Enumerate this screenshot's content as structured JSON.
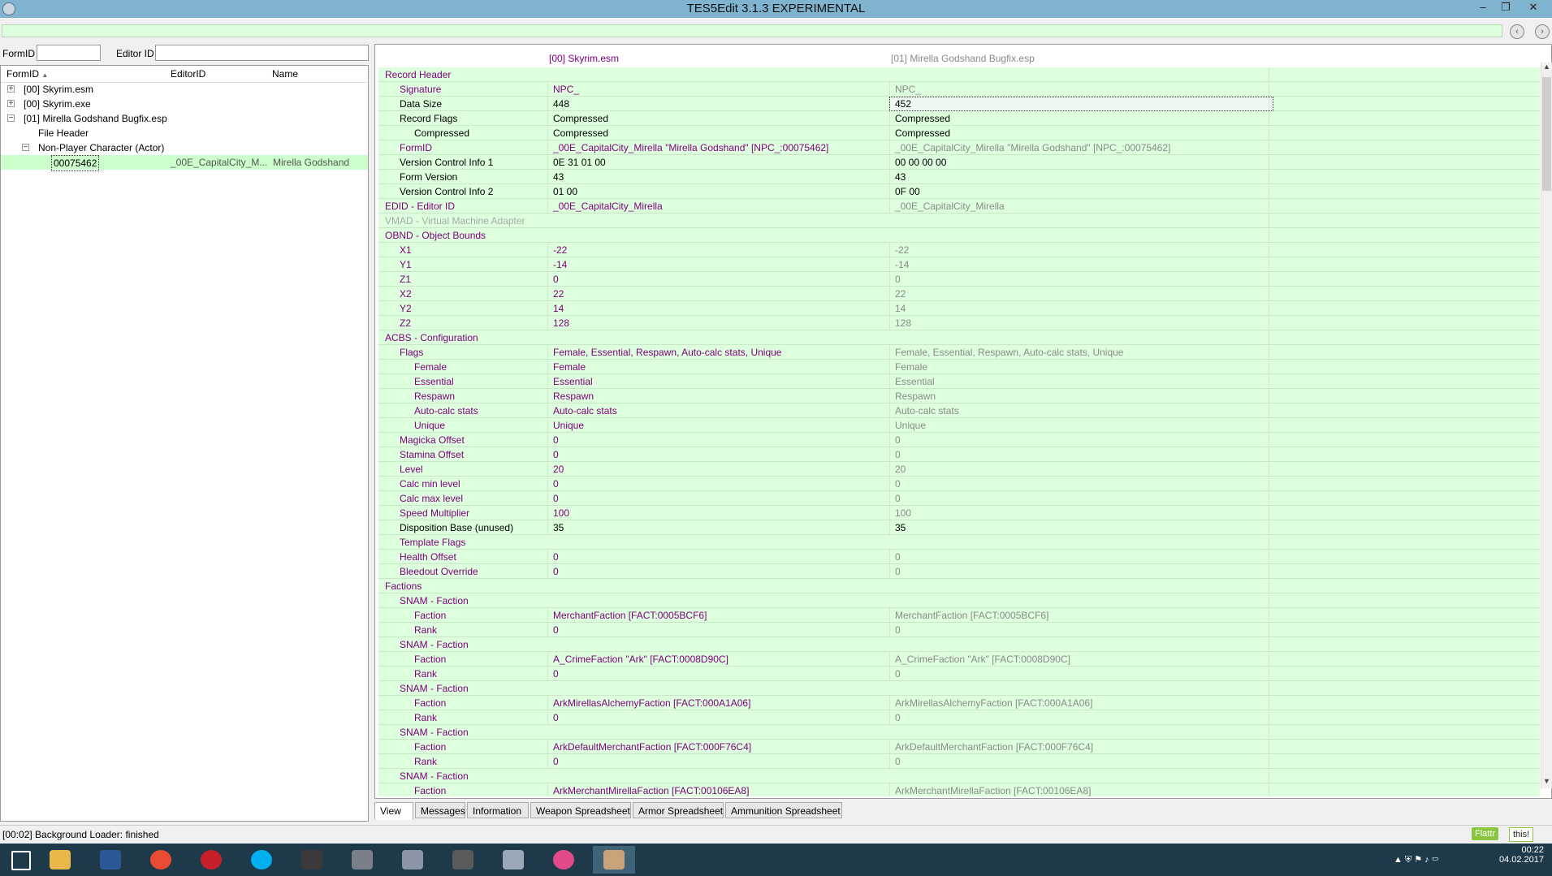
{
  "window": {
    "title": "TES5Edit 3.1.3 EXPERIMENTAL",
    "minimize": "–",
    "maximize": "❐",
    "close": "✕"
  },
  "filter": {
    "formid_label": "FormID",
    "editorid_label": "Editor ID",
    "formid_value": "",
    "editorid_value": ""
  },
  "nav": {
    "back": "‹",
    "forward": "›"
  },
  "tree": {
    "columns": [
      "FormID",
      "EditorID",
      "Name"
    ],
    "sort_indicator": "▲",
    "rows": [
      {
        "formid": "[00] Skyrim.esm",
        "editorid": "",
        "name": "",
        "expander": "+",
        "indent": 0
      },
      {
        "formid": "[00] Skyrim.exe",
        "editorid": "",
        "name": "",
        "expander": "+",
        "indent": 0
      },
      {
        "formid": "[01] Mirella Godshand Bugfix.esp",
        "editorid": "",
        "name": "",
        "expander": "−",
        "indent": 0
      },
      {
        "formid": "File Header",
        "editorid": "",
        "name": "",
        "expander": "",
        "indent": 1
      },
      {
        "formid": "Non-Player Character (Actor)",
        "editorid": "",
        "name": "",
        "expander": "−",
        "indent": 1
      },
      {
        "formid": "00075462",
        "editorid": "_00E_CapitalCity_M...",
        "name": "Mirella Godshand",
        "expander": "",
        "indent": 2,
        "selected": true
      }
    ]
  },
  "view": {
    "col1": "[00] Skyrim.esm",
    "col2": "[01] Mirella Godshand Bugfix.esp",
    "rows": [
      {
        "label": "Record Header",
        "v1": "",
        "v2": "",
        "indent": 0,
        "lc": "purple",
        "c1": "black",
        "c2": "black"
      },
      {
        "label": "Signature",
        "v1": "NPC_",
        "v2": "NPC_",
        "indent": 1,
        "lc": "purple",
        "c1": "purple",
        "c2": "gray"
      },
      {
        "label": "Data Size",
        "v1": "448",
        "v2": "452",
        "indent": 1,
        "lc": "black",
        "c1": "black",
        "c2": "black",
        "focus": true
      },
      {
        "label": "Record Flags",
        "v1": "Compressed",
        "v2": "Compressed",
        "indent": 1,
        "lc": "black",
        "c1": "black",
        "c2": "black"
      },
      {
        "label": "Compressed",
        "v1": "Compressed",
        "v2": "Compressed",
        "indent": 2,
        "lc": "black",
        "c1": "black",
        "c2": "black"
      },
      {
        "label": "FormID",
        "v1": "_00E_CapitalCity_Mirella \"Mirella Godshand\" [NPC_:00075462]",
        "v2": "_00E_CapitalCity_Mirella \"Mirella Godshand\" [NPC_:00075462]",
        "indent": 1,
        "lc": "purple",
        "c1": "purple",
        "c2": "gray"
      },
      {
        "label": "Version Control Info 1",
        "v1": "0E 31 01 00",
        "v2": "00 00 00 00",
        "indent": 1,
        "lc": "black",
        "c1": "black",
        "c2": "black"
      },
      {
        "label": "Form Version",
        "v1": "43",
        "v2": "43",
        "indent": 1,
        "lc": "black",
        "c1": "black",
        "c2": "black"
      },
      {
        "label": "Version Control Info 2",
        "v1": "01 00",
        "v2": "0F 00",
        "indent": 1,
        "lc": "black",
        "c1": "black",
        "c2": "black"
      },
      {
        "label": "EDID - Editor ID",
        "v1": "_00E_CapitalCity_Mirella",
        "v2": "_00E_CapitalCity_Mirella",
        "indent": 0,
        "lc": "purple",
        "c1": "purple",
        "c2": "gray"
      },
      {
        "label": "VMAD - Virtual Machine Adapter",
        "v1": "",
        "v2": "",
        "indent": 0,
        "lc": "lgray",
        "c1": "gray",
        "c2": "gray"
      },
      {
        "label": "OBND - Object Bounds",
        "v1": "",
        "v2": "",
        "indent": 0,
        "lc": "purple",
        "c1": "purple",
        "c2": "gray"
      },
      {
        "label": "X1",
        "v1": "-22",
        "v2": "-22",
        "indent": 1,
        "lc": "purple",
        "c1": "purple",
        "c2": "gray"
      },
      {
        "label": "Y1",
        "v1": "-14",
        "v2": "-14",
        "indent": 1,
        "lc": "purple",
        "c1": "purple",
        "c2": "gray"
      },
      {
        "label": "Z1",
        "v1": "0",
        "v2": "0",
        "indent": 1,
        "lc": "purple",
        "c1": "purple",
        "c2": "gray"
      },
      {
        "label": "X2",
        "v1": "22",
        "v2": "22",
        "indent": 1,
        "lc": "purple",
        "c1": "purple",
        "c2": "gray"
      },
      {
        "label": "Y2",
        "v1": "14",
        "v2": "14",
        "indent": 1,
        "lc": "purple",
        "c1": "purple",
        "c2": "gray"
      },
      {
        "label": "Z2",
        "v1": "128",
        "v2": "128",
        "indent": 1,
        "lc": "purple",
        "c1": "purple",
        "c2": "gray"
      },
      {
        "label": "ACBS - Configuration",
        "v1": "",
        "v2": "",
        "indent": 0,
        "lc": "purple",
        "c1": "purple",
        "c2": "gray"
      },
      {
        "label": "Flags",
        "v1": "Female, Essential, Respawn, Auto-calc stats, Unique",
        "v2": "Female, Essential, Respawn, Auto-calc stats, Unique",
        "indent": 1,
        "lc": "purple",
        "c1": "purple",
        "c2": "gray"
      },
      {
        "label": "Female",
        "v1": "Female",
        "v2": "Female",
        "indent": 2,
        "lc": "purple",
        "c1": "purple",
        "c2": "gray"
      },
      {
        "label": "Essential",
        "v1": "Essential",
        "v2": "Essential",
        "indent": 2,
        "lc": "purple",
        "c1": "purple",
        "c2": "gray"
      },
      {
        "label": "Respawn",
        "v1": "Respawn",
        "v2": "Respawn",
        "indent": 2,
        "lc": "purple",
        "c1": "purple",
        "c2": "gray"
      },
      {
        "label": "Auto-calc stats",
        "v1": "Auto-calc stats",
        "v2": "Auto-calc stats",
        "indent": 2,
        "lc": "purple",
        "c1": "purple",
        "c2": "gray"
      },
      {
        "label": "Unique",
        "v1": "Unique",
        "v2": "Unique",
        "indent": 2,
        "lc": "purple",
        "c1": "purple",
        "c2": "gray"
      },
      {
        "label": "Magicka Offset",
        "v1": "0",
        "v2": "0",
        "indent": 1,
        "lc": "purple",
        "c1": "purple",
        "c2": "gray"
      },
      {
        "label": "Stamina Offset",
        "v1": "0",
        "v2": "0",
        "indent": 1,
        "lc": "purple",
        "c1": "purple",
        "c2": "gray"
      },
      {
        "label": "Level",
        "v1": "20",
        "v2": "20",
        "indent": 1,
        "lc": "purple",
        "c1": "purple",
        "c2": "gray"
      },
      {
        "label": "Calc min level",
        "v1": "0",
        "v2": "0",
        "indent": 1,
        "lc": "purple",
        "c1": "purple",
        "c2": "gray"
      },
      {
        "label": "Calc max level",
        "v1": "0",
        "v2": "0",
        "indent": 1,
        "lc": "purple",
        "c1": "purple",
        "c2": "gray"
      },
      {
        "label": "Speed Multiplier",
        "v1": "100",
        "v2": "100",
        "indent": 1,
        "lc": "purple",
        "c1": "purple",
        "c2": "gray"
      },
      {
        "label": "Disposition Base (unused)",
        "v1": "35",
        "v2": "35",
        "indent": 1,
        "lc": "black",
        "c1": "black",
        "c2": "black"
      },
      {
        "label": "Template Flags",
        "v1": "",
        "v2": "",
        "indent": 1,
        "lc": "purple",
        "c1": "purple",
        "c2": "gray"
      },
      {
        "label": "Health Offset",
        "v1": "0",
        "v2": "0",
        "indent": 1,
        "lc": "purple",
        "c1": "purple",
        "c2": "gray"
      },
      {
        "label": "Bleedout Override",
        "v1": "0",
        "v2": "0",
        "indent": 1,
        "lc": "purple",
        "c1": "purple",
        "c2": "gray"
      },
      {
        "label": "Factions",
        "v1": "",
        "v2": "",
        "indent": 0,
        "lc": "purple",
        "c1": "purple",
        "c2": "gray"
      },
      {
        "label": "SNAM - Faction",
        "v1": "",
        "v2": "",
        "indent": 1,
        "lc": "purple",
        "c1": "purple",
        "c2": "gray"
      },
      {
        "label": "Faction",
        "v1": "MerchantFaction [FACT:0005BCF6]",
        "v2": "MerchantFaction [FACT:0005BCF6]",
        "indent": 2,
        "lc": "purple",
        "c1": "purple",
        "c2": "gray"
      },
      {
        "label": "Rank",
        "v1": "0",
        "v2": "0",
        "indent": 2,
        "lc": "purple",
        "c1": "purple",
        "c2": "gray"
      },
      {
        "label": "SNAM - Faction",
        "v1": "",
        "v2": "",
        "indent": 1,
        "lc": "purple",
        "c1": "purple",
        "c2": "gray"
      },
      {
        "label": "Faction",
        "v1": "A_CrimeFaction \"Ark\" [FACT:0008D90C]",
        "v2": "A_CrimeFaction \"Ark\" [FACT:0008D90C]",
        "indent": 2,
        "lc": "purple",
        "c1": "purple",
        "c2": "gray"
      },
      {
        "label": "Rank",
        "v1": "0",
        "v2": "0",
        "indent": 2,
        "lc": "purple",
        "c1": "purple",
        "c2": "gray"
      },
      {
        "label": "SNAM - Faction",
        "v1": "",
        "v2": "",
        "indent": 1,
        "lc": "purple",
        "c1": "purple",
        "c2": "gray"
      },
      {
        "label": "Faction",
        "v1": "ArkMirellasAlchemyFaction [FACT:000A1A06]",
        "v2": "ArkMirellasAlchemyFaction [FACT:000A1A06]",
        "indent": 2,
        "lc": "purple",
        "c1": "purple",
        "c2": "gray"
      },
      {
        "label": "Rank",
        "v1": "0",
        "v2": "0",
        "indent": 2,
        "lc": "purple",
        "c1": "purple",
        "c2": "gray"
      },
      {
        "label": "SNAM - Faction",
        "v1": "",
        "v2": "",
        "indent": 1,
        "lc": "purple",
        "c1": "purple",
        "c2": "gray"
      },
      {
        "label": "Faction",
        "v1": "ArkDefaultMerchantFaction [FACT:000F76C4]",
        "v2": "ArkDefaultMerchantFaction [FACT:000F76C4]",
        "indent": 2,
        "lc": "purple",
        "c1": "purple",
        "c2": "gray"
      },
      {
        "label": "Rank",
        "v1": "0",
        "v2": "0",
        "indent": 2,
        "lc": "purple",
        "c1": "purple",
        "c2": "gray"
      },
      {
        "label": "SNAM - Faction",
        "v1": "",
        "v2": "",
        "indent": 1,
        "lc": "purple",
        "c1": "purple",
        "c2": "gray"
      },
      {
        "label": "Faction",
        "v1": "ArkMerchantMirellaFaction [FACT:00106EA8]",
        "v2": "ArkMerchantMirellaFaction [FACT:00106EA8]",
        "indent": 2,
        "lc": "purple",
        "c1": "purple",
        "c2": "gray"
      }
    ]
  },
  "tabs": [
    "View",
    "Messages",
    "Information",
    "Weapon Spreadsheet",
    "Armor Spreadsheet",
    "Ammunition Spreadsheet"
  ],
  "status": {
    "text": "[00:02] Background Loader: finished",
    "flattr": "Flattr",
    "flattr_this": "this!"
  },
  "taskbar": {
    "apps": [
      "windows-start",
      "file-explorer",
      "word",
      "chrome",
      "app-red",
      "skype",
      "app-dark",
      "app-game",
      "app-x",
      "app-tank",
      "app-plane",
      "itunes",
      "tes5edit"
    ],
    "time": "00:22",
    "date": "04.02.2017",
    "tray_icons": "▲  ⛨  ⚑  ♪  ▭"
  },
  "colors": {
    "row_bg": "#ddffdd",
    "purple_text": "#800080",
    "title_bar": "#7fb3cf",
    "taskbar": "#1e3a4a"
  }
}
